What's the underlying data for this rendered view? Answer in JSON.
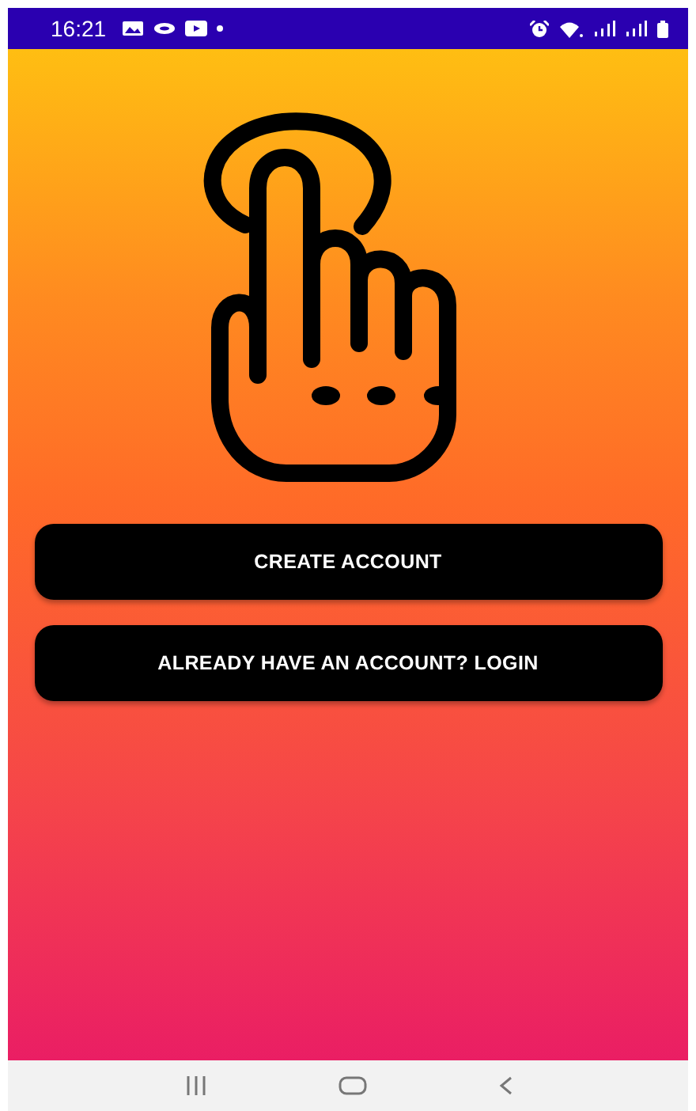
{
  "status_bar": {
    "time": "16:21"
  },
  "buttons": [
    {
      "label": "CREATE ACCOUNT"
    },
    {
      "label": "ALREADY HAVE AN ACCOUNT? LOGIN"
    }
  ]
}
